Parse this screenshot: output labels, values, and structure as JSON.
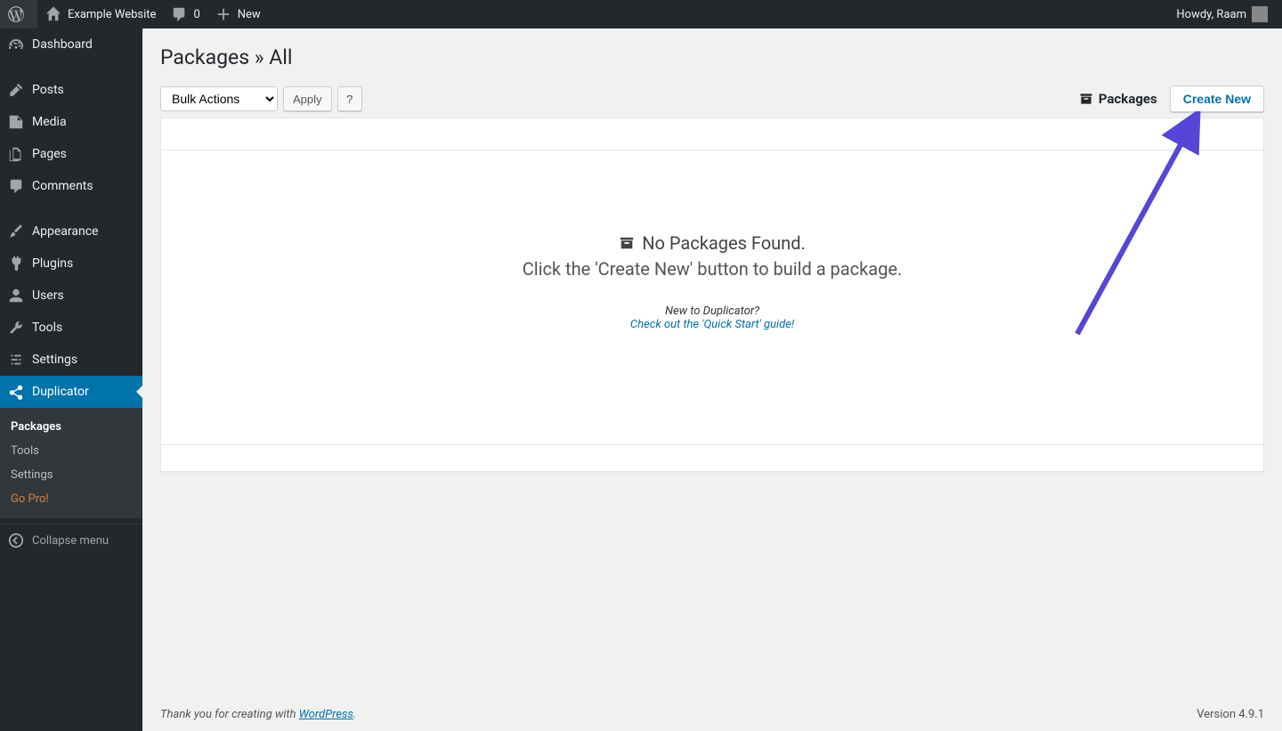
{
  "admin_bar": {
    "site_name": "Example Website",
    "comments_count": "0",
    "new_label": "New",
    "howdy": "Howdy, Raam"
  },
  "sidebar": {
    "items": [
      {
        "label": "Dashboard"
      },
      {
        "label": "Posts"
      },
      {
        "label": "Media"
      },
      {
        "label": "Pages"
      },
      {
        "label": "Comments"
      },
      {
        "label": "Appearance"
      },
      {
        "label": "Plugins"
      },
      {
        "label": "Users"
      },
      {
        "label": "Tools"
      },
      {
        "label": "Settings"
      },
      {
        "label": "Duplicator"
      }
    ],
    "submenu": [
      {
        "label": "Packages"
      },
      {
        "label": "Tools"
      },
      {
        "label": "Settings"
      },
      {
        "label": "Go Pro!"
      }
    ],
    "collapse_label": "Collapse menu"
  },
  "page": {
    "title": "Packages » All",
    "bulk_select": "Bulk Actions",
    "apply_label": "Apply",
    "packages_tab": "Packages",
    "create_button": "Create New",
    "empty_line1": "No Packages Found.",
    "empty_line2": "Click the 'Create New' button to build a package.",
    "help_q": "New to Duplicator?",
    "help_link": "Check out the 'Quick Start' guide!"
  },
  "footer": {
    "thankyou_pre": "Thank you for creating with ",
    "wp_link": "WordPress",
    "thankyou_post": ".",
    "version": "Version 4.9.1"
  }
}
